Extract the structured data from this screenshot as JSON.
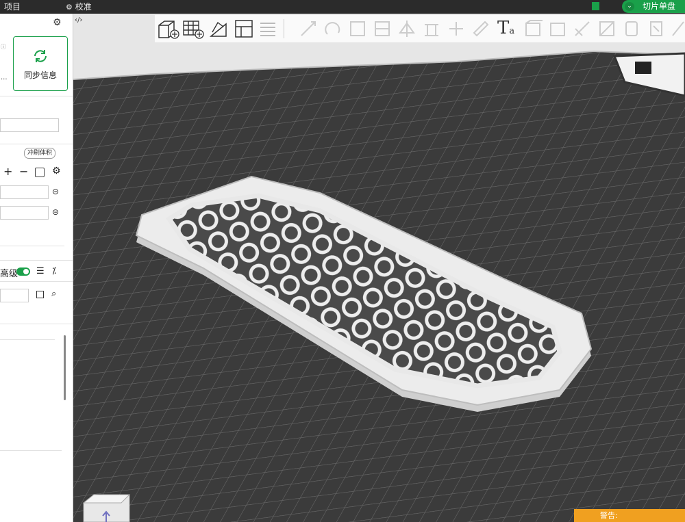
{
  "menubar": {
    "project": "项目",
    "calibrate": "校准",
    "slice_button": "切片单盘"
  },
  "sidebar": {
    "sync_button": "同步信息",
    "ellipsis": "...",
    "flush_volume": "冲刷体积",
    "plus": "+",
    "minus": "−",
    "advanced_label": "高级",
    "advanced_toggle_on": true
  },
  "toolbar": {
    "icons": [
      "add-cube-icon",
      "arrange-grid-icon",
      "auto-orient-icon",
      "layout-panel-icon",
      "list-icon",
      "move-icon",
      "rotate-icon",
      "scale-icon",
      "cut-icon",
      "mirror-icon",
      "text-icon",
      "support-icon",
      "seam-icon",
      "measure-icon",
      "assembly-icon",
      "split-icon",
      "view-icon"
    ],
    "text_tool_label": "T",
    "text_tool_sub": "a"
  },
  "status": {
    "warning": "警告:"
  },
  "colors": {
    "accent": "#1aa04a",
    "bed": "#3a3a3a",
    "grid": "#6e6e6e",
    "model": "#e8e8e8",
    "warning": "#f0a020"
  }
}
